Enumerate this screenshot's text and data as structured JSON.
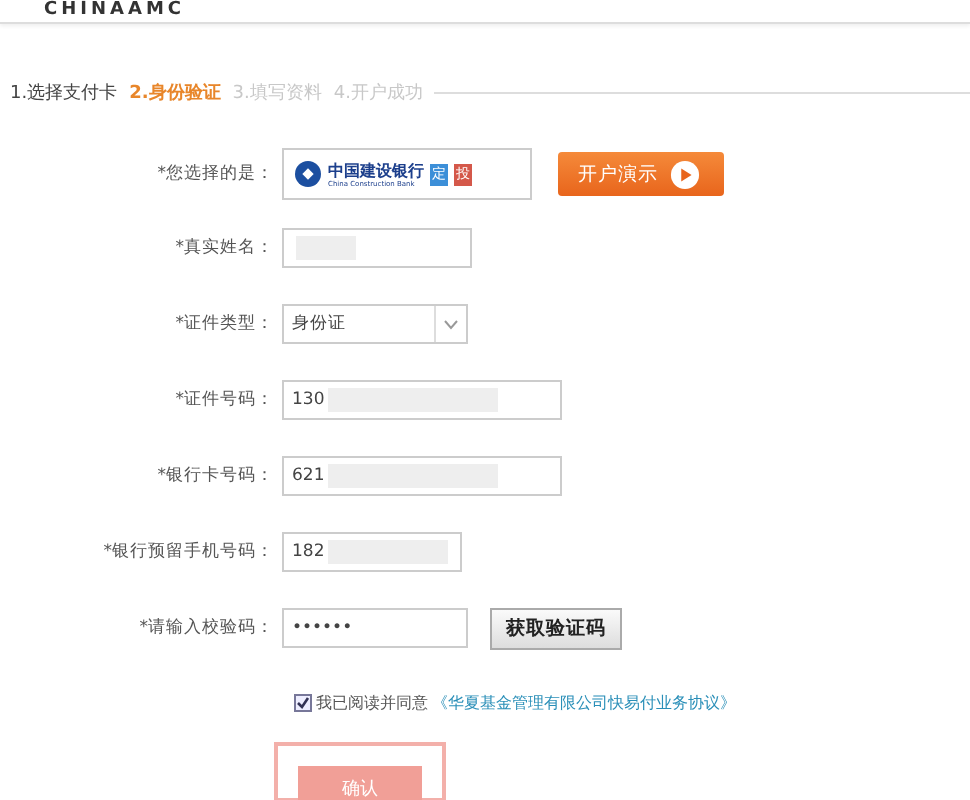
{
  "header": {
    "logo_text": "CHINAAMC"
  },
  "steps": [
    {
      "label": "1.选择支付卡",
      "selected": false,
      "completed": true
    },
    {
      "label": "2.身份验证",
      "selected": true,
      "completed": false
    },
    {
      "label": "3.填写资料",
      "selected": false,
      "completed": false
    },
    {
      "label": "4.开户成功",
      "selected": false,
      "completed": false
    }
  ],
  "bank": {
    "label": "*您选择的是：",
    "name": "中国建设银行",
    "name_en": "China Construction Bank",
    "badges": [
      "定",
      "投"
    ],
    "demo_button": "开户演示"
  },
  "fields": [
    {
      "kind": "text",
      "label": "*真实姓名：",
      "redacted": true
    },
    {
      "kind": "select",
      "label": "*证件类型：",
      "value": "身份证"
    },
    {
      "kind": "text",
      "label": "*证件号码：",
      "value": "130",
      "redacted": true
    },
    {
      "kind": "text",
      "label": "*银行卡号码：",
      "value": "621",
      "redacted": true
    },
    {
      "kind": "text",
      "label": "*银行预留手机号码：",
      "value": "182",
      "redacted": true
    },
    {
      "kind": "code",
      "label": "*请输入校验码：",
      "value": "••••••",
      "button": "获取验证码"
    }
  ],
  "agreement": {
    "checked": true,
    "text": "我已阅读并同意",
    "link": "《华夏基金管理有限公司快易付业务协议》"
  },
  "submit": {
    "label": "确认"
  }
}
